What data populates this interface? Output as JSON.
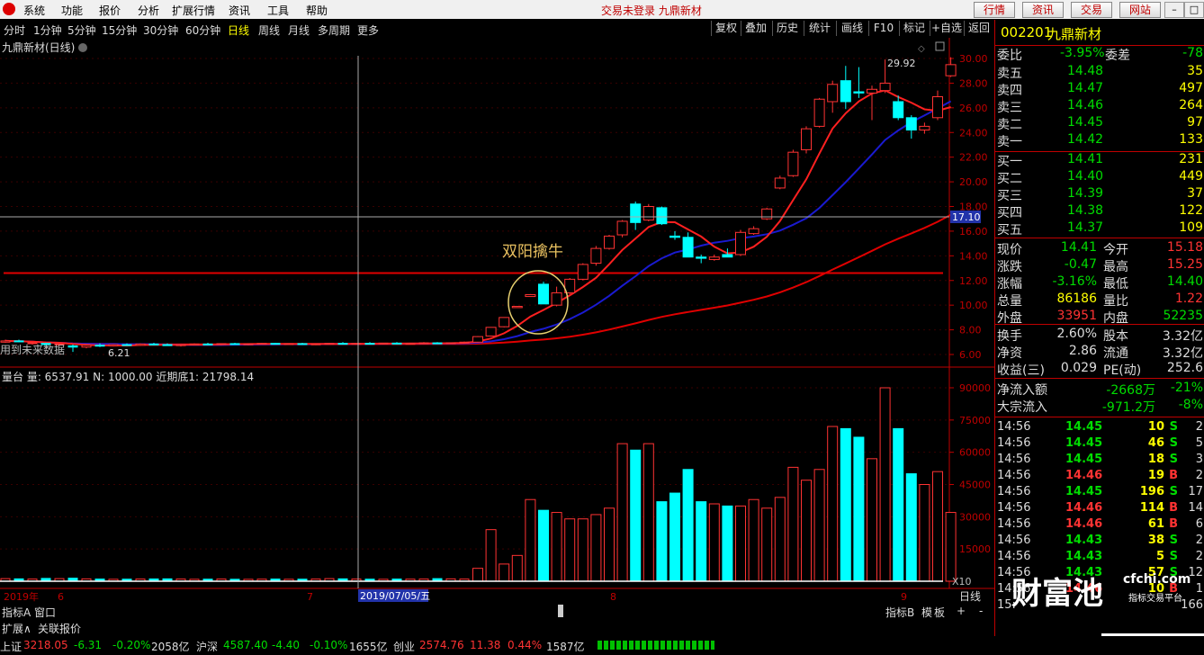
{
  "menu": {
    "items": [
      "系统",
      "功能",
      "报价",
      "分析",
      "扩展行情",
      "资讯",
      "工具",
      "帮助"
    ],
    "center": "交易未登录 九鼎新材",
    "buttons": [
      "行情",
      "资讯",
      "交易",
      "网站"
    ],
    "win": [
      "–",
      "□",
      "×"
    ]
  },
  "periods": [
    "分时",
    "1分钟",
    "5分钟",
    "15分钟",
    "30分钟",
    "60分钟",
    "日线",
    "周线",
    "月线",
    "多周期",
    "更多"
  ],
  "active_period": "日线",
  "right_tools": [
    "复权",
    "叠加",
    "历史",
    "统计",
    "画线",
    "F10",
    "标记",
    "+自选",
    "返回"
  ],
  "chart_title": "九鼎新材(日线)",
  "annotation": "双阳擒牛",
  "future_text": "用到未来数据",
  "low_label": "6.21",
  "high_label": "29.92",
  "crosshair_price": "17.10",
  "crosshair_date": "2019/07/05/五",
  "vol_header": "量台 量: 6537.91  N: 1000.00  近期底1: 21798.14",
  "vol_x10": "X10",
  "bottom_tabs": [
    "指标A",
    "窗口"
  ],
  "bottom_tabs2": [
    "扩展∧",
    "关联报价"
  ],
  "date_axis": {
    "year": "2019年",
    "m6": "6",
    "m7": "7",
    "m8": "8",
    "m9": "9",
    "view": "日线"
  },
  "lower_tools": [
    "指标B",
    "模",
    "板",
    "+",
    "-"
  ],
  "chart_data": {
    "type": "candlestick",
    "price_ticks": [
      "30.00",
      "28.00",
      "26.00",
      "24.00",
      "22.00",
      "20.00",
      "18.00",
      "16.00",
      "14.00",
      "12.00",
      "10.00",
      "8.00",
      "6.00"
    ],
    "volume_ticks": [
      "90000",
      "75000",
      "60000",
      "45000",
      "30000",
      "15000"
    ],
    "reference_line": 12.6,
    "candles": [
      {
        "o": 7.0,
        "h": 7.2,
        "l": 6.95,
        "c": 7.1,
        "v": 1200
      },
      {
        "o": 7.1,
        "h": 7.2,
        "l": 7.0,
        "c": 7.05,
        "v": 1100
      },
      {
        "o": 6.9,
        "h": 7.0,
        "l": 6.8,
        "c": 6.95,
        "v": 1000
      },
      {
        "o": 6.9,
        "h": 6.95,
        "l": 6.7,
        "c": 6.8,
        "v": 1300
      },
      {
        "o": 6.8,
        "h": 6.9,
        "l": 6.7,
        "c": 6.85,
        "v": 1200
      },
      {
        "o": 6.7,
        "h": 6.8,
        "l": 6.21,
        "c": 6.6,
        "v": 1400
      },
      {
        "o": 6.6,
        "h": 6.8,
        "l": 6.5,
        "c": 6.75,
        "v": 1100
      },
      {
        "o": 6.75,
        "h": 6.9,
        "l": 6.6,
        "c": 6.7,
        "v": 1000
      },
      {
        "o": 6.7,
        "h": 6.85,
        "l": 6.65,
        "c": 6.8,
        "v": 900
      },
      {
        "o": 6.8,
        "h": 6.9,
        "l": 6.7,
        "c": 6.75,
        "v": 950
      },
      {
        "o": 6.75,
        "h": 6.9,
        "l": 6.7,
        "c": 6.85,
        "v": 1000
      },
      {
        "o": 6.85,
        "h": 6.95,
        "l": 6.75,
        "c": 6.8,
        "v": 1050
      },
      {
        "o": 6.8,
        "h": 6.9,
        "l": 6.7,
        "c": 6.72,
        "v": 1100
      },
      {
        "o": 6.72,
        "h": 6.85,
        "l": 6.65,
        "c": 6.8,
        "v": 1000
      },
      {
        "o": 6.8,
        "h": 6.9,
        "l": 6.75,
        "c": 6.85,
        "v": 900
      },
      {
        "o": 6.85,
        "h": 6.95,
        "l": 6.8,
        "c": 6.82,
        "v": 950
      },
      {
        "o": 6.82,
        "h": 6.9,
        "l": 6.75,
        "c": 6.88,
        "v": 1000
      },
      {
        "o": 6.88,
        "h": 6.95,
        "l": 6.8,
        "c": 6.83,
        "v": 900
      },
      {
        "o": 6.83,
        "h": 6.9,
        "l": 6.75,
        "c": 6.86,
        "v": 880
      },
      {
        "o": 6.86,
        "h": 6.95,
        "l": 6.8,
        "c": 6.9,
        "v": 950
      },
      {
        "o": 6.9,
        "h": 6.95,
        "l": 6.8,
        "c": 6.84,
        "v": 1000
      },
      {
        "o": 6.84,
        "h": 6.9,
        "l": 6.78,
        "c": 6.88,
        "v": 900
      },
      {
        "o": 6.88,
        "h": 6.95,
        "l": 6.8,
        "c": 6.82,
        "v": 950
      },
      {
        "o": 6.82,
        "h": 6.9,
        "l": 6.76,
        "c": 6.86,
        "v": 1000
      },
      {
        "o": 6.86,
        "h": 6.95,
        "l": 6.8,
        "c": 6.9,
        "v": 1200
      },
      {
        "o": 6.9,
        "h": 7.0,
        "l": 6.8,
        "c": 6.85,
        "v": 1100
      },
      {
        "o": 6.85,
        "h": 6.95,
        "l": 6.78,
        "c": 6.9,
        "v": 1000
      },
      {
        "o": 6.9,
        "h": 7.0,
        "l": 6.82,
        "c": 6.86,
        "v": 950
      },
      {
        "o": 6.86,
        "h": 6.95,
        "l": 6.8,
        "c": 6.92,
        "v": 900
      },
      {
        "o": 6.92,
        "h": 7.0,
        "l": 6.85,
        "c": 6.88,
        "v": 1000
      },
      {
        "o": 6.88,
        "h": 6.95,
        "l": 6.82,
        "c": 6.9,
        "v": 950
      },
      {
        "o": 6.9,
        "h": 7.0,
        "l": 6.85,
        "c": 6.94,
        "v": 1000
      },
      {
        "o": 6.94,
        "h": 7.0,
        "l": 6.88,
        "c": 6.9,
        "v": 1200
      },
      {
        "o": 6.9,
        "h": 6.98,
        "l": 6.84,
        "c": 6.95,
        "v": 1100
      },
      {
        "o": 6.95,
        "h": 7.05,
        "l": 6.9,
        "c": 7.0,
        "v": 1000
      },
      {
        "o": 7.0,
        "h": 7.5,
        "l": 6.95,
        "c": 7.45,
        "v": 6000
      },
      {
        "o": 7.5,
        "h": 8.2,
        "l": 7.45,
        "c": 8.2,
        "v": 24000
      },
      {
        "o": 8.25,
        "h": 9.0,
        "l": 8.2,
        "c": 9.0,
        "v": 8000
      },
      {
        "o": 9.8,
        "h": 9.9,
        "l": 9.8,
        "c": 9.9,
        "v": 12000
      },
      {
        "o": 10.7,
        "h": 10.9,
        "l": 10.7,
        "c": 10.85,
        "v": 38000
      },
      {
        "o": 11.7,
        "h": 11.9,
        "l": 10.1,
        "c": 10.1,
        "v": 33000
      },
      {
        "o": 10.0,
        "h": 11.5,
        "l": 9.9,
        "c": 11.0,
        "v": 32000
      },
      {
        "o": 11.0,
        "h": 12.2,
        "l": 10.9,
        "c": 12.1,
        "v": 29000
      },
      {
        "o": 12.1,
        "h": 13.4,
        "l": 12.0,
        "c": 13.3,
        "v": 29000
      },
      {
        "o": 13.4,
        "h": 14.8,
        "l": 13.2,
        "c": 14.6,
        "v": 31000
      },
      {
        "o": 14.6,
        "h": 15.7,
        "l": 14.5,
        "c": 15.6,
        "v": 34000
      },
      {
        "o": 15.7,
        "h": 16.9,
        "l": 15.5,
        "c": 16.8,
        "v": 64000
      },
      {
        "o": 18.2,
        "h": 18.4,
        "l": 16.1,
        "c": 16.7,
        "v": 61000
      },
      {
        "o": 16.9,
        "h": 18.2,
        "l": 16.8,
        "c": 18.0,
        "v": 64000
      },
      {
        "o": 17.9,
        "h": 18.0,
        "l": 16.5,
        "c": 16.6,
        "v": 37000
      },
      {
        "o": 15.6,
        "h": 16.0,
        "l": 15.3,
        "c": 15.5,
        "v": 41000
      },
      {
        "o": 15.5,
        "h": 15.9,
        "l": 13.9,
        "c": 13.9,
        "v": 52000
      },
      {
        "o": 13.9,
        "h": 14.1,
        "l": 13.4,
        "c": 13.8,
        "v": 37000
      },
      {
        "o": 13.7,
        "h": 14.1,
        "l": 13.6,
        "c": 13.9,
        "v": 36000
      },
      {
        "o": 14.1,
        "h": 14.6,
        "l": 13.9,
        "c": 13.9,
        "v": 35000
      },
      {
        "o": 14.1,
        "h": 16.1,
        "l": 14.0,
        "c": 15.9,
        "v": 35000
      },
      {
        "o": 15.8,
        "h": 16.4,
        "l": 15.7,
        "c": 16.2,
        "v": 38000
      },
      {
        "o": 17.0,
        "h": 17.9,
        "l": 16.9,
        "c": 17.8,
        "v": 34000
      },
      {
        "o": 19.5,
        "h": 20.5,
        "l": 19.4,
        "c": 20.3,
        "v": 39000
      },
      {
        "o": 20.5,
        "h": 22.6,
        "l": 20.4,
        "c": 22.4,
        "v": 53000
      },
      {
        "o": 22.6,
        "h": 24.5,
        "l": 22.3,
        "c": 24.3,
        "v": 47000
      },
      {
        "o": 24.5,
        "h": 26.8,
        "l": 24.4,
        "c": 26.7,
        "v": 52000
      },
      {
        "o": 26.5,
        "h": 28.2,
        "l": 25.6,
        "c": 27.9,
        "v": 72000
      },
      {
        "o": 28.2,
        "h": 29.4,
        "l": 25.9,
        "c": 26.5,
        "v": 71000
      },
      {
        "o": 27.3,
        "h": 29.3,
        "l": 26.8,
        "c": 27.2,
        "v": 67000
      },
      {
        "o": 27.2,
        "h": 27.8,
        "l": 25.0,
        "c": 27.5,
        "v": 57000
      },
      {
        "o": 27.4,
        "h": 29.92,
        "l": 27.2,
        "c": 28.0,
        "v": 90000
      },
      {
        "o": 26.5,
        "h": 27.0,
        "l": 25.0,
        "c": 25.2,
        "v": 71000
      },
      {
        "o": 25.2,
        "h": 25.4,
        "l": 23.5,
        "c": 24.2,
        "v": 50000
      },
      {
        "o": 24.2,
        "h": 24.8,
        "l": 23.9,
        "c": 24.5,
        "v": 45000
      },
      {
        "o": 25.2,
        "h": 27.4,
        "l": 25.0,
        "c": 26.9,
        "v": 51000
      },
      {
        "o": 28.6,
        "h": 30.1,
        "l": 28.5,
        "c": 29.5,
        "v": 32000
      }
    ],
    "first_dense_index": 35
  },
  "quote": {
    "code": "002201",
    "name": "九鼎新材",
    "weibi_label": "委比",
    "weibi": "-3.95%",
    "weicha_label": "委差",
    "weicha": "-78",
    "asks": [
      {
        "label": "卖五",
        "price": "14.48",
        "vol": "35"
      },
      {
        "label": "卖四",
        "price": "14.47",
        "vol": "497"
      },
      {
        "label": "卖三",
        "price": "14.46",
        "vol": "264"
      },
      {
        "label": "卖二",
        "price": "14.45",
        "vol": "97"
      },
      {
        "label": "卖一",
        "price": "14.42",
        "vol": "133"
      }
    ],
    "bids": [
      {
        "label": "买一",
        "price": "14.41",
        "vol": "231"
      },
      {
        "label": "买二",
        "price": "14.40",
        "vol": "449"
      },
      {
        "label": "买三",
        "price": "14.39",
        "vol": "37"
      },
      {
        "label": "买四",
        "price": "14.38",
        "vol": "122"
      },
      {
        "label": "买五",
        "price": "14.37",
        "vol": "109"
      }
    ],
    "stats": [
      {
        "l1": "现价",
        "v1": "14.41",
        "c1": "dn",
        "l2": "今开",
        "v2": "15.18",
        "c2": "up"
      },
      {
        "l1": "涨跌",
        "v1": "-0.47",
        "c1": "dn",
        "l2": "最高",
        "v2": "15.25",
        "c2": "up"
      },
      {
        "l1": "涨幅",
        "v1": "-3.16%",
        "c1": "dn",
        "l2": "最低",
        "v2": "14.40",
        "c2": "dn"
      },
      {
        "l1": "总量",
        "v1": "86186",
        "c1": "ye",
        "l2": "量比",
        "v2": "1.22",
        "c2": "up"
      },
      {
        "l1": "外盘",
        "v1": "33951",
        "c1": "up",
        "l2": "内盘",
        "v2": "52235",
        "c2": "dn"
      }
    ],
    "stats2": [
      {
        "l1": "换手",
        "v1": "2.60%",
        "c1": "wh",
        "l2": "股本",
        "v2": "3.32亿",
        "c2": "wh"
      },
      {
        "l1": "净资",
        "v1": "2.86",
        "c1": "wh",
        "l2": "流通",
        "v2": "3.32亿",
        "c2": "wh"
      },
      {
        "l1": "收益(三)",
        "v1": "0.029",
        "c1": "wh",
        "l2": "PE(动)",
        "v2": "252.6",
        "c2": "wh"
      }
    ],
    "flow": [
      {
        "l": "净流入额",
        "v": "-2668万",
        "p": "-21%"
      },
      {
        "l": "大宗流入",
        "v": "-971.2万",
        "p": "-8%"
      }
    ],
    "ticks": [
      {
        "t": "14:56",
        "p": "14.45",
        "v": "10",
        "s": "S",
        "n": "2"
      },
      {
        "t": "14:56",
        "p": "14.45",
        "v": "46",
        "s": "S",
        "n": "5"
      },
      {
        "t": "14:56",
        "p": "14.45",
        "v": "18",
        "s": "S",
        "n": "3"
      },
      {
        "t": "14:56",
        "p": "14.46",
        "v": "19",
        "s": "B",
        "n": "2"
      },
      {
        "t": "14:56",
        "p": "14.45",
        "v": "196",
        "s": "S",
        "n": "17"
      },
      {
        "t": "14:56",
        "p": "14.46",
        "v": "114",
        "s": "B",
        "n": "14"
      },
      {
        "t": "14:56",
        "p": "14.46",
        "v": "61",
        "s": "B",
        "n": "6"
      },
      {
        "t": "14:56",
        "p": "14.43",
        "v": "38",
        "s": "S",
        "n": "2"
      },
      {
        "t": "14:56",
        "p": "14.43",
        "v": "5",
        "s": "S",
        "n": "2"
      },
      {
        "t": "14:56",
        "p": "14.43",
        "v": "57",
        "s": "S",
        "n": "12"
      },
      {
        "t": "14:56",
        "p": "14.46",
        "v": "10",
        "s": "B",
        "n": "1"
      },
      {
        "t": "15:",
        "p": "",
        "v": "",
        "s": "",
        "n": "166"
      }
    ],
    "tabs": [
      "笔",
      "价",
      "细",
      "势",
      "联",
      "值",
      "主",
      "筹"
    ]
  },
  "status": {
    "sh_label": "上证",
    "sh_val": "3218.05",
    "sh_chg": "-6.31",
    "sh_pct": "-0.20%",
    "sh_amt": "2058亿",
    "hs_label": "沪深",
    "hs_val": "4587.40",
    "hs_chg": "-4.40",
    "hs_pct": "-0.10%",
    "hs_amt": "1655亿",
    "cy_label": "创业",
    "cy_val": "2574.76",
    "cy_chg": "11.38",
    "cy_pct": "0.44%",
    "cy_amt": "1587亿"
  },
  "watermark": {
    "logo": "财富池",
    "site": "cfchi.com",
    "sub": "指标交易平台"
  },
  "ime": "拼 英"
}
